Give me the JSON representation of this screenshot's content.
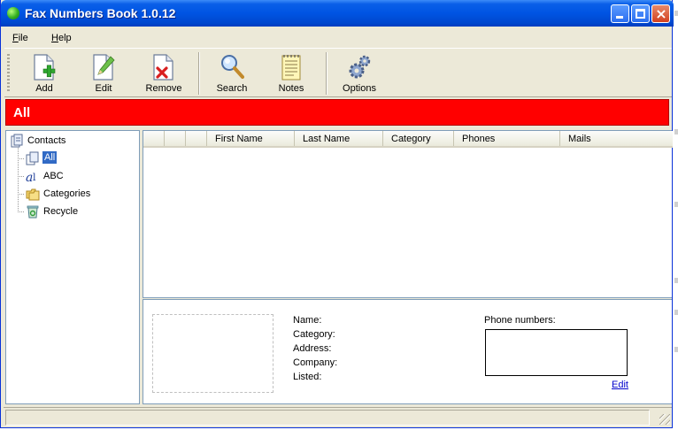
{
  "window": {
    "title": "Fax Numbers Book 1.0.12"
  },
  "menu": [
    {
      "accel": "F",
      "rest": "ile"
    },
    {
      "accel": "H",
      "rest": "elp"
    }
  ],
  "toolbar": {
    "add": "Add",
    "edit": "Edit",
    "remove": "Remove",
    "search": "Search",
    "notes": "Notes",
    "options": "Options"
  },
  "banner": {
    "title": "All",
    "color": "#ff0000"
  },
  "tree": {
    "root": "Contacts",
    "items": [
      {
        "label": "All",
        "icon": "documents-icon",
        "selected": true
      },
      {
        "label": "ABC",
        "icon": "alphabet-icon"
      },
      {
        "label": "Categories",
        "icon": "folders-icon"
      },
      {
        "label": "Recycle",
        "icon": "recycle-bin-icon"
      }
    ]
  },
  "grid": {
    "columns": [
      "First Name",
      "Last Name",
      "Category",
      "Phones",
      "Mails"
    ],
    "rows": []
  },
  "details": {
    "name_label": "Name:",
    "category_label": "Category:",
    "address_label": "Address:",
    "company_label": "Company:",
    "listed_label": "Listed:",
    "phones_label": "Phone numbers:",
    "edit_link": "Edit"
  },
  "colors": {
    "titlebar": "#0054e3",
    "selection": "#316ac5",
    "link": "#0000cc"
  }
}
